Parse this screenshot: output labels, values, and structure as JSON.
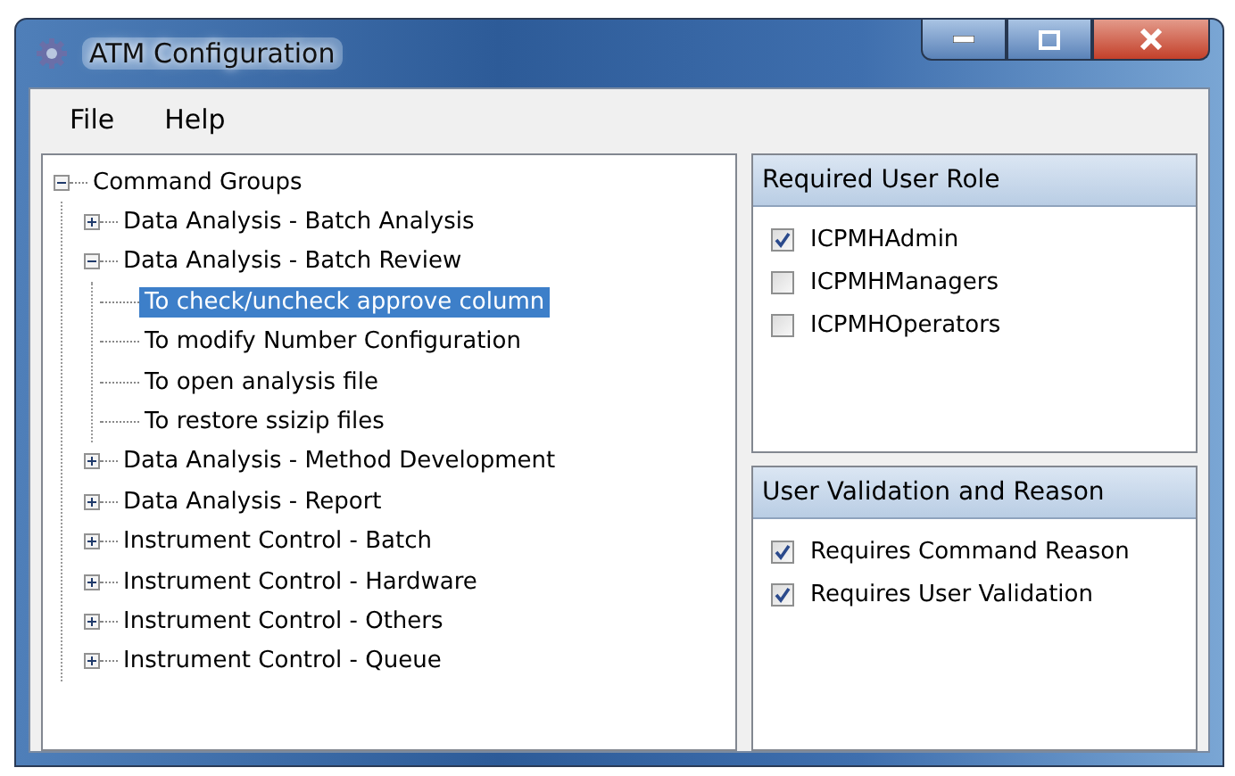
{
  "window": {
    "title": "ATM Configuration"
  },
  "menu": [
    {
      "label": "File"
    },
    {
      "label": "Help"
    }
  ],
  "tree": [
    {
      "label": "Command Groups",
      "expanded": true,
      "selected": false,
      "children": [
        {
          "label": "Data Analysis - Batch Analysis",
          "expanded": false,
          "selected": false
        },
        {
          "label": "Data Analysis - Batch Review",
          "expanded": true,
          "selected": false,
          "children": [
            {
              "label": "To check/uncheck approve column",
              "selected": true
            },
            {
              "label": "To modify Number Configuration",
              "selected": false
            },
            {
              "label": "To open analysis file",
              "selected": false
            },
            {
              "label": "To restore ssizip files",
              "selected": false
            }
          ]
        },
        {
          "label": "Data Analysis - Method Development",
          "expanded": false,
          "selected": false
        },
        {
          "label": "Data Analysis - Report",
          "expanded": false,
          "selected": false
        },
        {
          "label": "Instrument Control - Batch",
          "expanded": false,
          "selected": false
        },
        {
          "label": "Instrument Control - Hardware",
          "expanded": false,
          "selected": false
        },
        {
          "label": "Instrument Control - Others",
          "expanded": false,
          "selected": false
        },
        {
          "label": "Instrument Control - Queue",
          "expanded": false,
          "selected": false
        }
      ]
    }
  ],
  "panels": [
    {
      "title": "Required User Role",
      "items": [
        {
          "label": "ICPMHAdmin",
          "checked": true
        },
        {
          "label": "ICPMHManagers",
          "checked": false
        },
        {
          "label": "ICPMHOperators",
          "checked": false
        }
      ]
    },
    {
      "title": "User Validation and Reason",
      "items": [
        {
          "label": "Requires Command Reason",
          "checked": true
        },
        {
          "label": "Requires User Validation",
          "checked": true
        }
      ]
    }
  ]
}
